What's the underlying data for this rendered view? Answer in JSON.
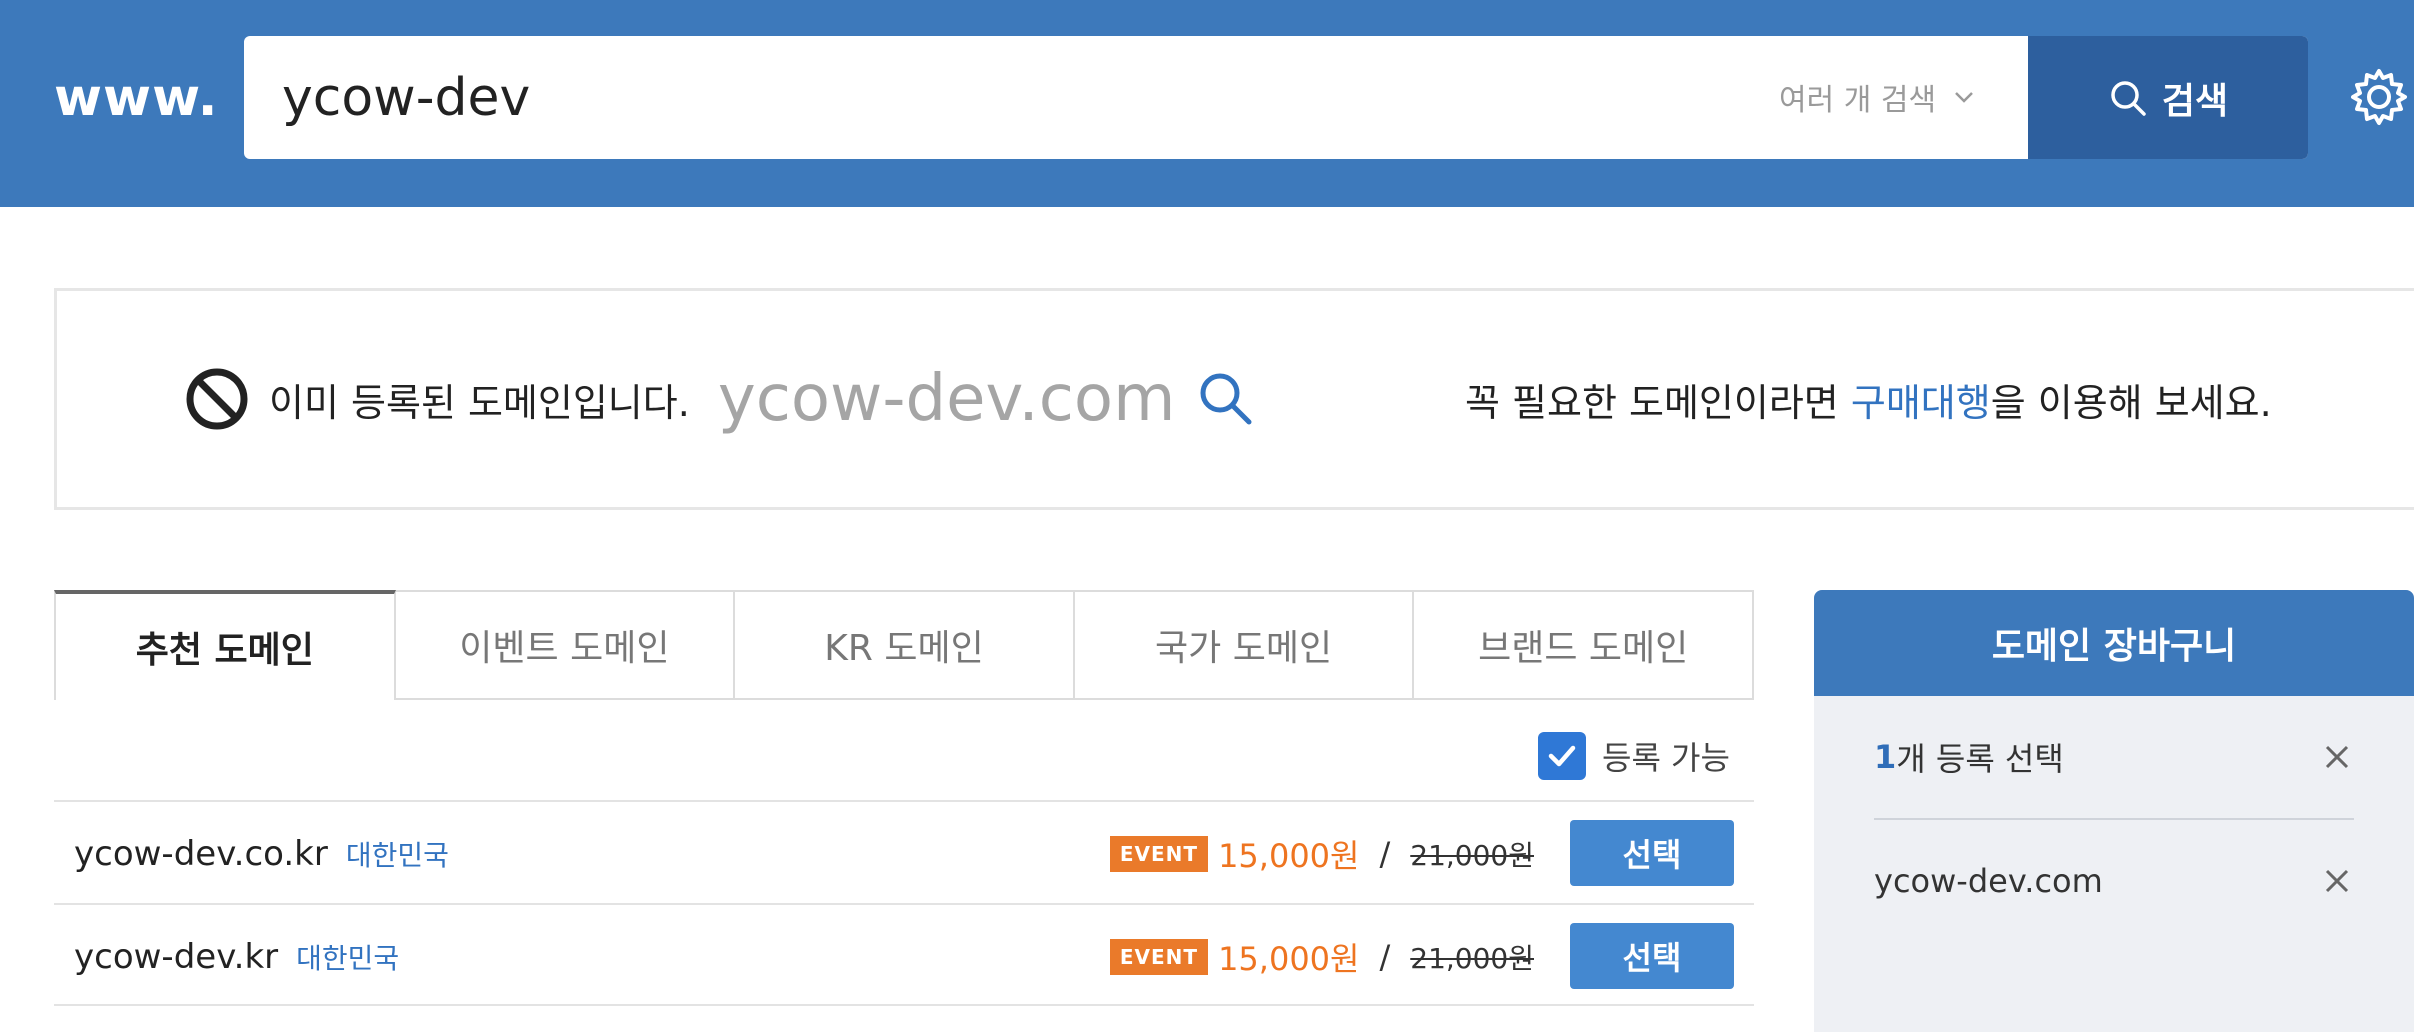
{
  "header": {
    "prefix": "www.",
    "search_value": "ycow-dev",
    "multi_search_label": "여러 개 검색",
    "search_button_label": "검색"
  },
  "notice": {
    "status_text": "이미 등록된 도메인입니다.",
    "domain": "ycow-dev.com",
    "tip_prefix": "꼭 필요한 도메인이라면",
    "tip_link": "구매대행",
    "tip_suffix": "을 이용해 보세요."
  },
  "tabs": [
    {
      "label": "추천 도메인",
      "active": true
    },
    {
      "label": "이벤트 도메인",
      "active": false
    },
    {
      "label": "KR 도메인",
      "active": false
    },
    {
      "label": "국가 도메인",
      "active": false
    },
    {
      "label": "브랜드 도메인",
      "active": false
    }
  ],
  "filter": {
    "available_label": "등록 가능",
    "checked": true
  },
  "results": [
    {
      "domain": "ycow-dev.co.kr",
      "country": "대한민국",
      "badge": "EVENT",
      "price": "15,000원",
      "separator": "/",
      "old_price": "21,000원",
      "button": "선택"
    },
    {
      "domain": "ycow-dev.kr",
      "country": "대한민국",
      "badge": "EVENT",
      "price": "15,000원",
      "separator": "/",
      "old_price": "21,000원",
      "button": "선택"
    }
  ],
  "cart": {
    "title": "도메인 장바구니",
    "count": "1",
    "count_suffix": "개 등록 선택",
    "items": [
      "ycow-dev.com"
    ]
  },
  "colors": {
    "header_bg": "#3d79bb",
    "search_button_bg": "#2d5f9e",
    "link_blue": "#3273c0",
    "event_orange": "#ea7a2a",
    "select_button": "#4488d0"
  },
  "icons": [
    "search-icon",
    "chevron-down-icon",
    "gear-icon",
    "ban-icon",
    "check-icon",
    "close-icon"
  ]
}
